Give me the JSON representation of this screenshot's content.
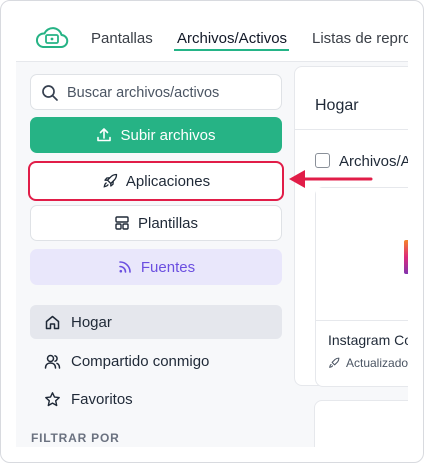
{
  "nav": {
    "tabs": [
      {
        "label": "Pantallas"
      },
      {
        "label": "Archivos/Activos"
      },
      {
        "label": "Listas de repro"
      }
    ],
    "active_tab_index": 1
  },
  "sidebar": {
    "search": {
      "placeholder": "Buscar archivos/activos"
    },
    "upload_label": "Subir archivos",
    "apps_label": "Aplicaciones",
    "templates_label": "Plantillas",
    "feeds_label": "Fuentes",
    "items": [
      {
        "label": "Hogar",
        "icon": "home-icon",
        "active": true
      },
      {
        "label": "Compartido conmigo",
        "icon": "users-icon",
        "active": false
      },
      {
        "label": "Favoritos",
        "icon": "star-icon",
        "active": false
      }
    ],
    "filter_label": "FILTRAR POR"
  },
  "main": {
    "title": "Hogar",
    "select_all_label": "Archivos/A",
    "card": {
      "title": "Instagram Co",
      "meta": "Actualizado"
    }
  },
  "colors": {
    "brand": "#26b385",
    "highlight": "#e11d48",
    "feeds": "#6b4fe0"
  }
}
